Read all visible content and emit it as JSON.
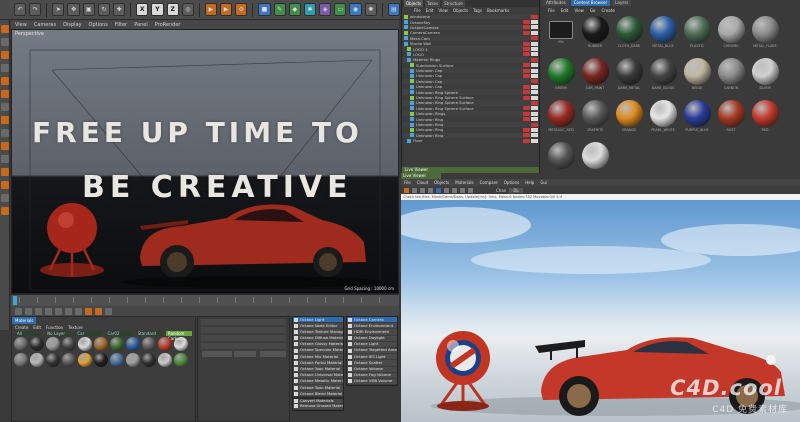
{
  "colors": {
    "accent_blue": "#2f6db0",
    "accent_orange": "#c86a1e",
    "car_red": "#c4382a",
    "sky": "#9cc3e6"
  },
  "toolbar": {
    "axis_buttons": [
      "X",
      "Y",
      "Z"
    ]
  },
  "viewport": {
    "menu": [
      "View",
      "Cameras",
      "Display",
      "Options",
      "Filter",
      "Panel",
      "ProRender"
    ],
    "label": "Perspective",
    "headline_line1": "FREE UP TIME TO",
    "headline_line2": "BE CREATIVE",
    "grid_spacing": "Grid Spacing : 10000 cm"
  },
  "material_manager": {
    "tab": "Materials",
    "menu": [
      "Create",
      "Edit",
      "Function",
      "Texture"
    ],
    "columns": [
      "All",
      "No Layer",
      "Car",
      "Car02",
      "Standard",
      "Random Carbon"
    ],
    "swatches": [
      {
        "color": "#6d6d6d"
      },
      {
        "color": "#2d2d2d"
      },
      {
        "color": "#9a9a9a"
      },
      {
        "color": "#444444"
      },
      {
        "color": "#d8d8d8"
      },
      {
        "color": "#a56a2a"
      },
      {
        "color": "#3d6e32"
      },
      {
        "color": "#2b5fa8"
      },
      {
        "color": "#5a5a5a"
      },
      {
        "color": "#c23b2b"
      },
      {
        "color": "#dcdcdc"
      },
      {
        "color": "#7a7a7a"
      },
      {
        "color": "#b7b7b7"
      },
      {
        "color": "#333333"
      },
      {
        "color": "#585858"
      },
      {
        "color": "#e0a030"
      },
      {
        "color": "#1e1e1e"
      },
      {
        "color": "#466e9e"
      },
      {
        "color": "#9c9c9c"
      },
      {
        "color": "#2f2f2f"
      },
      {
        "color": "#c9c9c9"
      },
      {
        "color": "#4d8c3a"
      }
    ]
  },
  "octane_menu_left": {
    "items": [
      "Octane Light",
      "Octane Node Editor",
      "Octane Texture Manager",
      "Octane Diffuse Material",
      "Octane Glossy Material",
      "Octane Specular Material",
      "Octane Mix Material",
      "Octane Portal Material",
      "Octane Toon Material",
      "Octane Universal Material",
      "Octane Metallic Material",
      "Octane Toon Material",
      "Octane Blend Material",
      "Convert Materials",
      "Remove Unused Materials"
    ]
  },
  "octane_menu_right": {
    "items": [
      "Octane Camera",
      "Octane Environment",
      "HDRI Environment",
      "Octane Daylight",
      "Octane Light",
      "Octane Targetted Arealight",
      "Octane IES Light",
      "Octane Scatter",
      "Octane Volume",
      "Octane Fog Volume",
      "Octane VDB Volume"
    ]
  },
  "object_manager": {
    "tabs": [
      "Objects",
      "Takes",
      "Structure"
    ],
    "menu": [
      "File",
      "Edit",
      "View",
      "Objects",
      "Tags",
      "Bookmarks"
    ],
    "rows": [
      "windscene",
      "OctaneSky",
      "OctaneCamera",
      "CameraCamera",
      "Mesh.Cam",
      "Studio Wall",
      "LOGO 1",
      "LOGO",
      "Material Rings",
      "Subdivision Surface",
      "Unknown Cap",
      "Unknown Cap",
      "Unknown Cap",
      "Unknown Cap",
      "Unknown Ring Sphere",
      "Unknown Ring Sphere Surface",
      "Unknown Ring Sphere Surface",
      "Unknown Ring Sphere Surface",
      "Unknown Rings",
      "Unknown Ring",
      "Unknown Ring",
      "Unknown Ring",
      "Unknown Ring",
      "Floor"
    ],
    "bottom_tab": "Live Viewer"
  },
  "content_browser": {
    "tabs": [
      "Attributes",
      "Content Browser",
      "Layers"
    ],
    "menu": [
      "File",
      "Edit",
      "View",
      "Go",
      "Create"
    ],
    "items": [
      {
        "label": "file",
        "folder": true
      },
      {
        "label": "RUBBER",
        "color": "#1a1a1a"
      },
      {
        "label": "CLOTH_DARK",
        "color": "#2c5a3a"
      },
      {
        "label": "METAL_BLUE",
        "color": "#2b5fa8"
      },
      {
        "label": "PLASTIC",
        "color": "#4c6d55"
      },
      {
        "label": "CHROME",
        "color": "#a9a9a9"
      },
      {
        "label": "METAL_FLAKE",
        "color": "#8c8c8c"
      },
      {
        "label": "GREEN",
        "color": "#1f7a2a"
      },
      {
        "label": "CAR_PAINT",
        "color": "#7a2620"
      },
      {
        "label": "DARK_METAL",
        "color": "#3a3a3a"
      },
      {
        "label": "DARK_GLOSS",
        "color": "#444444"
      },
      {
        "label": "BEIGE",
        "color": "#bfb7a1"
      },
      {
        "label": "CARBON",
        "color": "#8c8c8c"
      },
      {
        "label": "SILVER",
        "color": "#d0d0d0"
      },
      {
        "label": "METALLIC_RED",
        "color": "#9a2a22"
      },
      {
        "label": "GRAPHITE",
        "color": "#5a5a5a"
      },
      {
        "label": "ORANGE",
        "color": "#e08b1f"
      },
      {
        "label": "PEARL_WHITE",
        "color": "#e6e6e6"
      },
      {
        "label": "PURPLE_BLUE",
        "color": "#2a3d9a"
      },
      {
        "label": "RUST",
        "color": "#a83a22"
      },
      {
        "label": "RED",
        "color": "#c43a2c"
      },
      {
        "label": "",
        "color": "#555555"
      },
      {
        "label": "",
        "color": "#dcdcdc"
      }
    ]
  },
  "live_viewer": {
    "menu": [
      "File",
      "Cloud",
      "Objects",
      "Materials",
      "Compare",
      "Options",
      "Help",
      "Gui"
    ],
    "channel_label": "Chan",
    "channel_value": "DL",
    "status": "Check tex-files. Mesh/Cams/Daas. Update[ms]: 0ms. Mesh:6 Nodes:782 Movable:0/0 4.4"
  },
  "watermark": {
    "line1": "C4D.cool",
    "line2": "C4D 免费素材库"
  }
}
